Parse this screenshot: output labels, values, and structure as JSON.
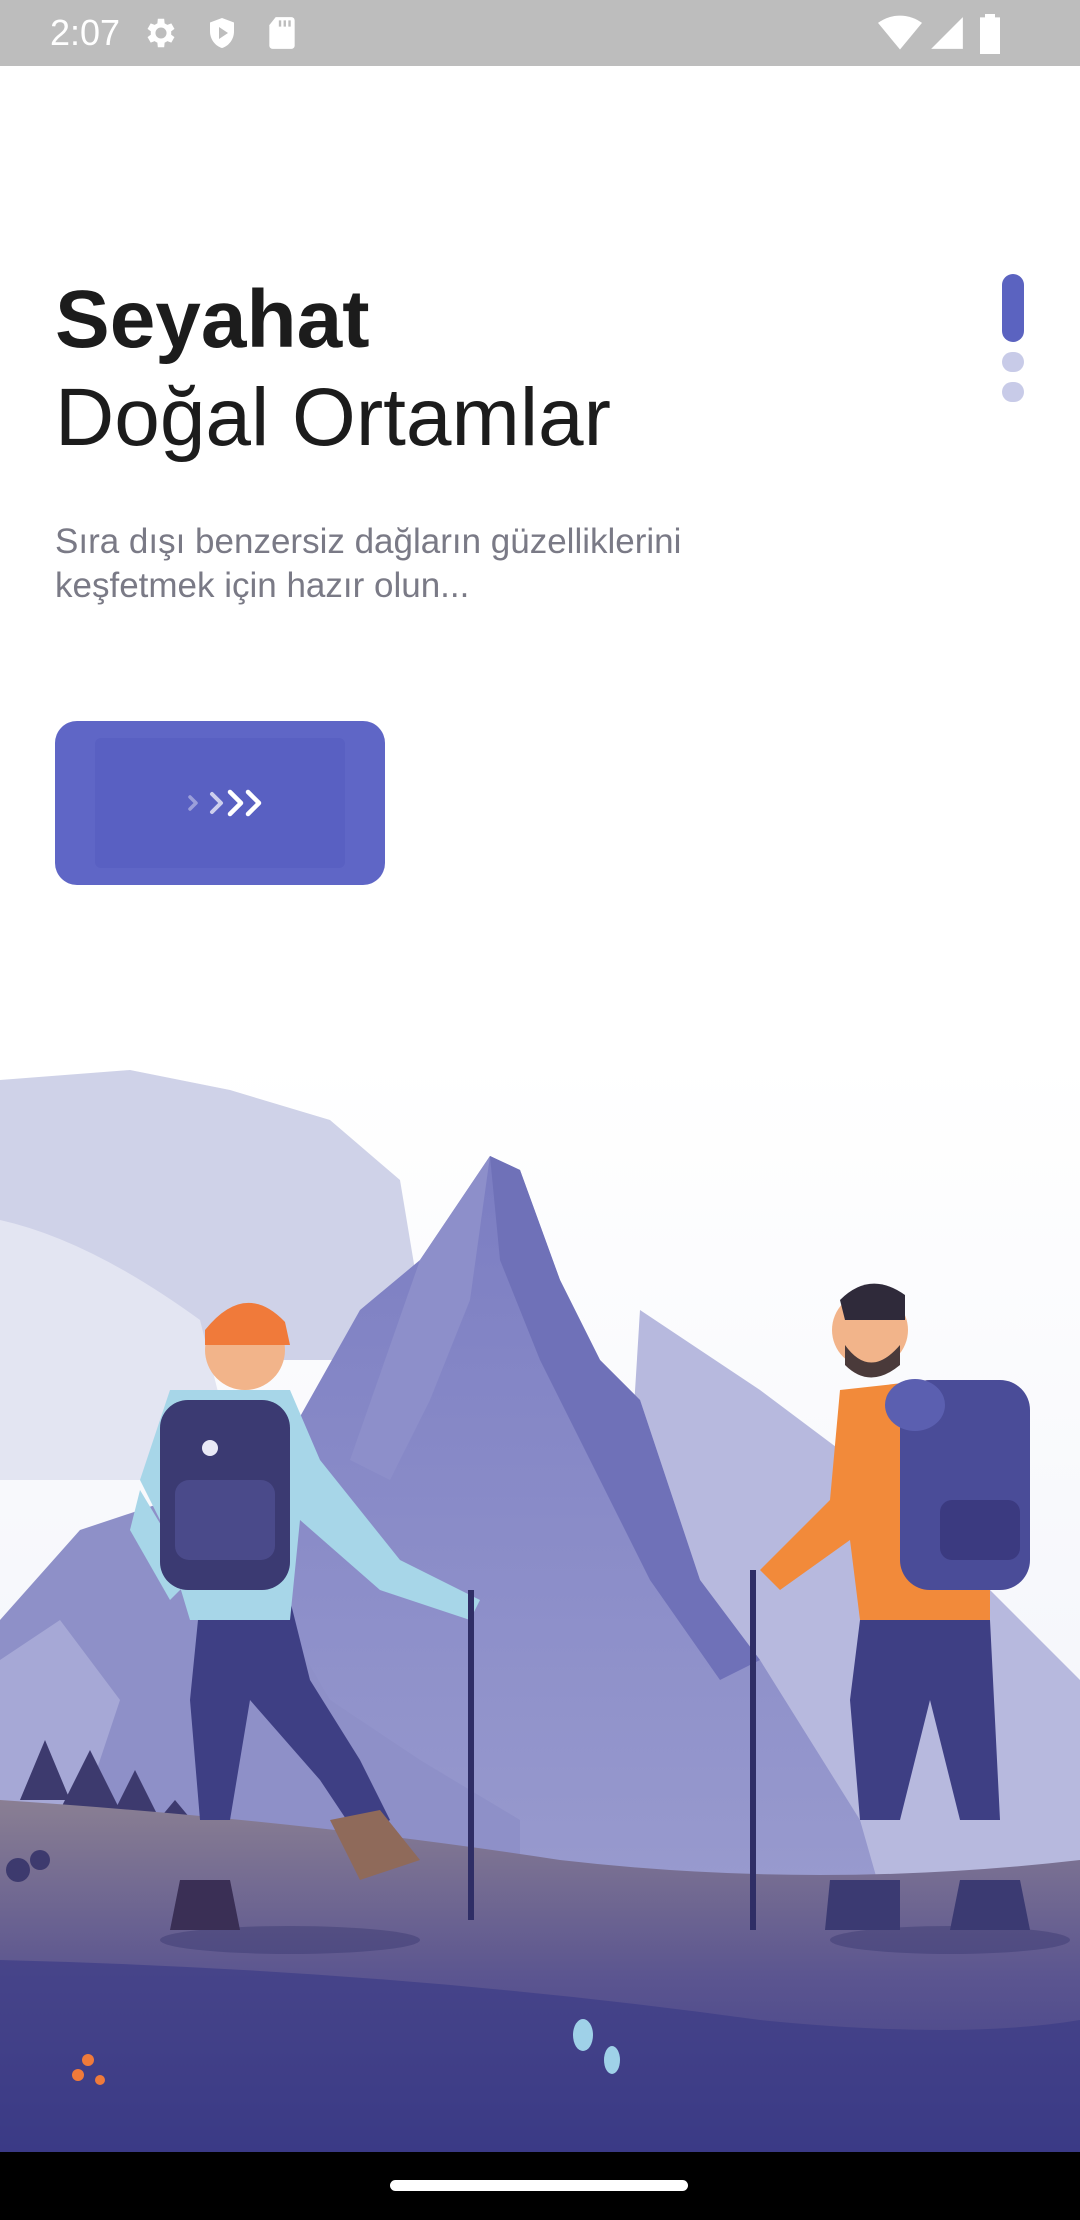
{
  "status_bar": {
    "time": "2:07",
    "left_icons": [
      "gear-icon",
      "shield-play-icon",
      "sd-card-icon"
    ],
    "right_icons": [
      "wifi-icon",
      "cell-signal-icon",
      "battery-icon"
    ]
  },
  "onboarding": {
    "title": "Seyahat",
    "subtitle": "Doğal Ortamlar",
    "description": "Sıra dışı benzersiz dağların güzelliklerini keşfetmek için hazır olun...",
    "next_button_icon": "triple-chevron-right-icon",
    "page_indicator": {
      "total": 3,
      "active": 1
    }
  },
  "colors": {
    "accent": "#5f66c6",
    "indicator_active": "#5b63c0",
    "indicator_inactive": "#c8cbe8",
    "title_text": "#1c1c1c",
    "description_text": "#7a7a86"
  },
  "illustration": "hikers-mountain-illustration"
}
